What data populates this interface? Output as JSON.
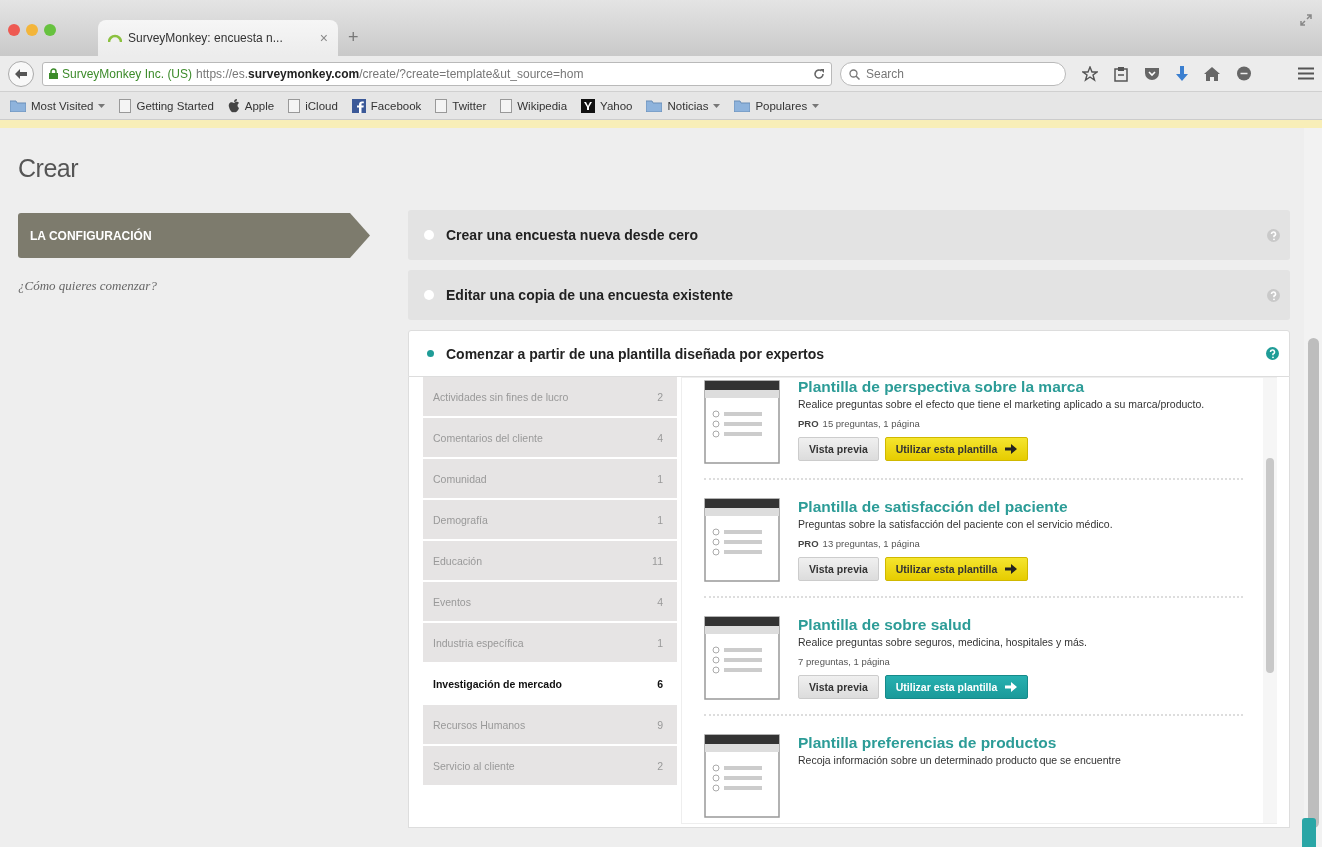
{
  "browser": {
    "tab_title": "SurveyMonkey: encuesta n...",
    "tab_close": "×",
    "new_tab": "+",
    "site_identity": "SurveyMonkey Inc. (US)",
    "url": "https://es.**surveymonkey.com**/create/?create=template&ut_source=hom",
    "search_placeholder": "Search",
    "bookmarks": [
      {
        "kind": "folder",
        "label": "Most Visited",
        "menu": true
      },
      {
        "kind": "page",
        "label": "Getting Started",
        "menu": false
      },
      {
        "kind": "apple",
        "label": "Apple",
        "menu": false
      },
      {
        "kind": "page",
        "label": "iCloud",
        "menu": false
      },
      {
        "kind": "facebook",
        "label": "Facebook",
        "menu": false
      },
      {
        "kind": "page",
        "label": "Twitter",
        "menu": false
      },
      {
        "kind": "page",
        "label": "Wikipedia",
        "menu": false
      },
      {
        "kind": "yahoo",
        "label": "Yahoo",
        "menu": false
      },
      {
        "kind": "folder",
        "label": "Noticias",
        "menu": true
      },
      {
        "kind": "folder",
        "label": "Populares",
        "menu": true
      }
    ]
  },
  "page": {
    "title": "Crear",
    "step": "LA CONFIGURACIÓN",
    "question": "¿Cómo quieres comenzar?",
    "options": [
      {
        "label": "Crear una encuesta nueva desde cero",
        "selected": false
      },
      {
        "label": "Editar una copia de una encuesta existente",
        "selected": false
      },
      {
        "label": "Comenzar a partir de una plantilla diseñada por expertos",
        "selected": true
      }
    ],
    "categories": [
      {
        "label": "Actividades sin fines de lucro",
        "count": "2",
        "selected": false
      },
      {
        "label": "Comentarios del cliente",
        "count": "4",
        "selected": false
      },
      {
        "label": "Comunidad",
        "count": "1",
        "selected": false
      },
      {
        "label": "Demografía",
        "count": "1",
        "selected": false
      },
      {
        "label": "Educación",
        "count": "11",
        "selected": false
      },
      {
        "label": "Eventos",
        "count": "4",
        "selected": false
      },
      {
        "label": "Industria específica",
        "count": "1",
        "selected": false
      },
      {
        "label": "Investigación de mercado",
        "count": "6",
        "selected": true
      },
      {
        "label": "Recursos Humanos",
        "count": "9",
        "selected": false
      },
      {
        "label": "Servicio al cliente",
        "count": "2",
        "selected": false
      }
    ],
    "templates": [
      {
        "title": "Plantilla de perspectiva sobre la marca",
        "description": "Realice preguntas sobre el efecto que tiene el marketing aplicado a su marca/producto.",
        "badge": "PRO",
        "meta": "15 preguntas, 1 página",
        "preview": "Vista previa",
        "use": "Utilizar esta plantilla",
        "highlighted": false
      },
      {
        "title": "Plantilla de satisfacción del paciente",
        "description": "Preguntas sobre la satisfacción del paciente con el servicio médico.",
        "badge": "PRO",
        "meta": "13 preguntas, 1 página",
        "preview": "Vista previa",
        "use": "Utilizar esta plantilla",
        "highlighted": false
      },
      {
        "title": "Plantilla de sobre salud",
        "description": "Realice preguntas sobre seguros, medicina, hospitales y más.",
        "meta": "7 preguntas, 1 página",
        "preview": "Vista previa",
        "use": "Utilizar esta plantilla",
        "highlighted": true
      },
      {
        "title": "Plantilla preferencias de productos",
        "description": "Recoja información sobre un determinado producto que se encuentre"
      }
    ]
  }
}
